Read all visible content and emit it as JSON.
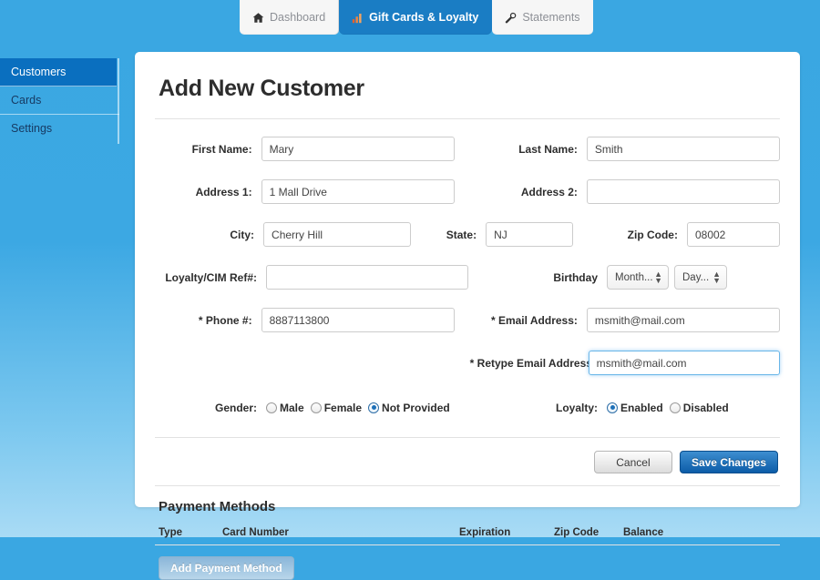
{
  "topnav": {
    "tabs": [
      {
        "label": "Dashboard",
        "icon": "home-icon",
        "active": false
      },
      {
        "label": "Gift Cards & Loyalty",
        "icon": "bar-chart-icon",
        "active": true
      },
      {
        "label": "Statements",
        "icon": "wrench-icon",
        "active": false
      }
    ]
  },
  "sidebar": {
    "items": [
      {
        "label": "Customers",
        "active": true
      },
      {
        "label": "Cards",
        "active": false
      },
      {
        "label": "Settings",
        "active": false
      }
    ]
  },
  "page": {
    "title": "Add New Customer",
    "section_title": "Payment Methods"
  },
  "form": {
    "first_name": {
      "label": "First Name:",
      "value": "Mary"
    },
    "last_name": {
      "label": "Last Name:",
      "value": "Smith"
    },
    "address1": {
      "label": "Address 1:",
      "value": "1 Mall Drive"
    },
    "address2": {
      "label": "Address 2:",
      "value": ""
    },
    "city": {
      "label": "City:",
      "value": "Cherry Hill"
    },
    "state": {
      "label": "State:",
      "value": "NJ"
    },
    "zip": {
      "label": "Zip Code:",
      "value": "08002"
    },
    "loyalty_ref": {
      "label": "Loyalty/CIM Ref#:",
      "value": ""
    },
    "birthday": {
      "label": "Birthday",
      "month": "Month...",
      "day": "Day..."
    },
    "phone": {
      "label": "* Phone #:",
      "value": "8887113800"
    },
    "email": {
      "label": "* Email Address:",
      "value": "msmith@mail.com"
    },
    "retype_email": {
      "label": "* Retype Email Address:",
      "value": "msmith@mail.com"
    },
    "gender": {
      "label": "Gender:",
      "options": [
        {
          "label": "Male",
          "selected": false
        },
        {
          "label": "Female",
          "selected": false
        },
        {
          "label": "Not Provided",
          "selected": true
        }
      ]
    },
    "loyalty": {
      "label": "Loyalty:",
      "options": [
        {
          "label": "Enabled",
          "selected": true
        },
        {
          "label": "Disabled",
          "selected": false
        }
      ]
    }
  },
  "actions": {
    "cancel": "Cancel",
    "save": "Save Changes"
  },
  "payment_methods": {
    "columns": [
      "Type",
      "Card Number",
      "Expiration",
      "Zip Code",
      "Balance"
    ],
    "rows": [],
    "add_button": "Add Payment Method"
  },
  "colors": {
    "page_bg_top": "#3aa7e2",
    "page_bg_bottom": "#a9dbf5",
    "tab_active": "#1a7dc4",
    "sidebar_active": "#0a6fbf",
    "primary_button": "#0c5ca8",
    "focus_border": "#69b6e8"
  }
}
